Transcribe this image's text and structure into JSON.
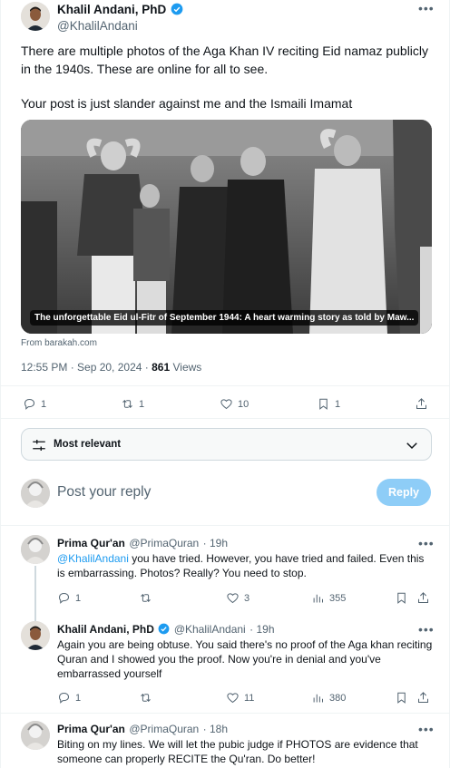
{
  "main_tweet": {
    "author_name": "Khalil Andani, PhD",
    "author_handle": "@KhalilAndani",
    "text_p1": "There are multiple photos of the Aga Khan IV reciting Eid namaz publicly in the 1940s. These are online for all to see.",
    "text_p2": "Your post is just slander against me and the Ismaili Imamat",
    "card_caption": "The unforgettable Eid ul-Fitr of September 1944: A heart warming story as told by Maw...",
    "card_source": "From barakah.com",
    "time": "12:55 PM · Sep 20, 2024 ·",
    "views_count": "861",
    "views_label": "Views",
    "replies": "1",
    "reposts": "1",
    "likes": "10",
    "bookmarks": "1"
  },
  "sort": {
    "label": "Most relevant"
  },
  "reply_box": {
    "placeholder": "Post your reply",
    "button": "Reply"
  },
  "replies": [
    {
      "author_name": "Prima Qur'an",
      "author_handle": "@PrimaQuran",
      "time": "· 19h",
      "mention": "@KhalilAndani",
      "text": " you have tried.  However, you have tried and failed. Even this is embarrassing. Photos? Really? You need to stop.",
      "replies": "1",
      "reposts": "",
      "likes": "3",
      "views": "355"
    },
    {
      "author_name": "Khalil Andani, PhD",
      "author_handle": "@KhalilAndani",
      "time": "· 19h",
      "text": "Again you are being obtuse. You said there's no proof of the Aga khan reciting Quran and I showed you the proof. Now you're in denial and you've embarrassed yourself",
      "replies": "1",
      "reposts": "",
      "likes": "11",
      "views": "380"
    },
    {
      "author_name": "Prima Qur'an",
      "author_handle": "@PrimaQuran",
      "time": "· 18h",
      "text": "Biting on my lines. We will let the pubic judge if PHOTOS are evidence that someone can properly RECITE the Qu'ran. Do better!"
    }
  ],
  "colors": {
    "accent": "#1d9bf0",
    "muted": "#536471",
    "reply_button_disabled": "#8ecdf7"
  }
}
